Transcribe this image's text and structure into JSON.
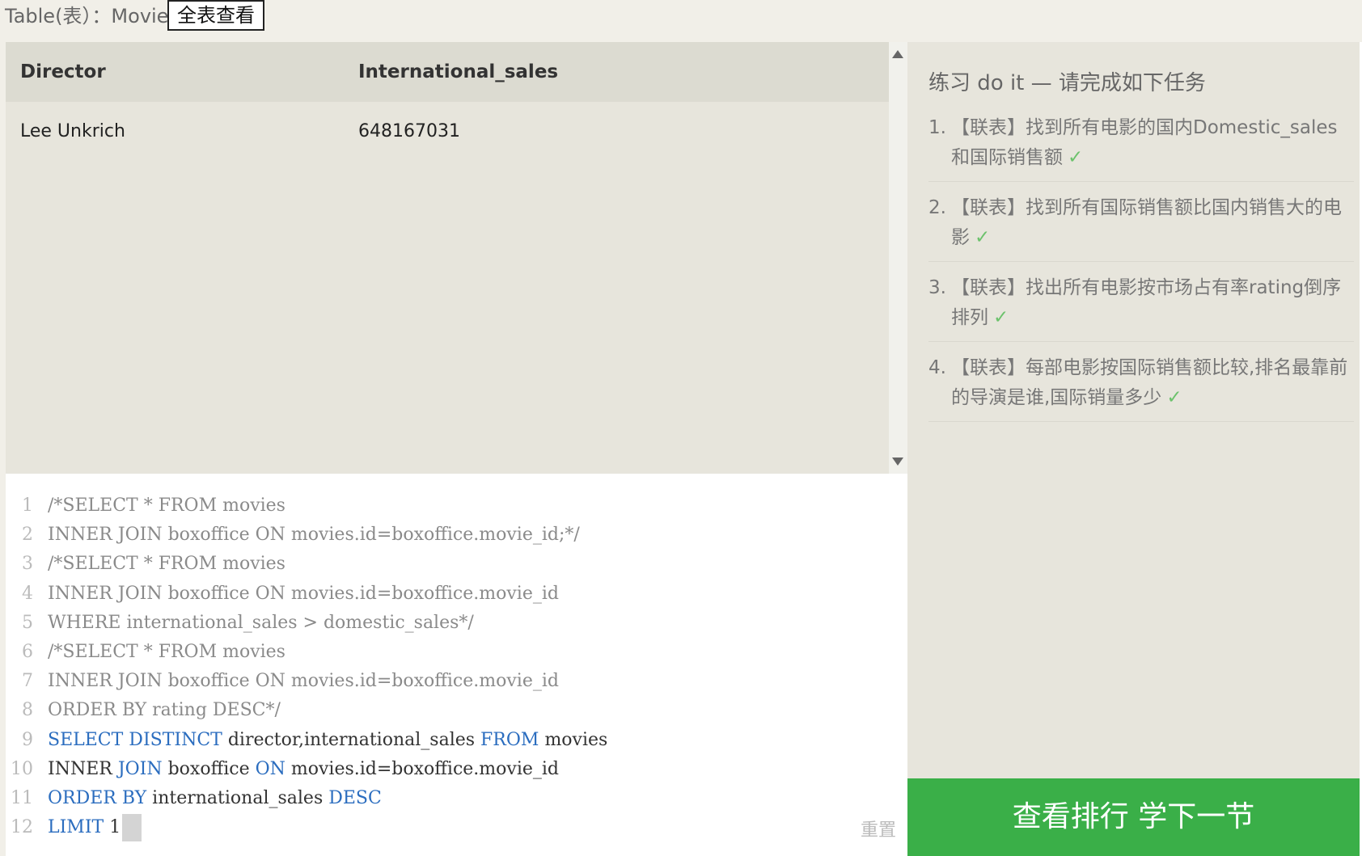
{
  "topbar": {
    "table_label": "Table(表）：Movies",
    "view_all_button": "全表查看"
  },
  "results": {
    "columns": [
      "Director",
      "International_sales"
    ],
    "rows": [
      [
        "Lee Unkrich",
        "648167031"
      ]
    ]
  },
  "editor": {
    "lines": [
      {
        "num": "1",
        "parts": [
          {
            "t": "/*SELECT * FROM movies",
            "c": "cm"
          }
        ]
      },
      {
        "num": "2",
        "parts": [
          {
            "t": "INNER JOIN boxoffice ON movies.id=boxoffice.movie_id;*/",
            "c": "cm"
          }
        ]
      },
      {
        "num": "3",
        "parts": [
          {
            "t": "/*SELECT * FROM movies",
            "c": "cm"
          }
        ]
      },
      {
        "num": "4",
        "parts": [
          {
            "t": "INNER JOIN boxoffice ON movies.id=boxoffice.movie_id",
            "c": "cm"
          }
        ]
      },
      {
        "num": "5",
        "parts": [
          {
            "t": "WHERE international_sales > domestic_sales*/",
            "c": "cm"
          }
        ]
      },
      {
        "num": "6",
        "parts": [
          {
            "t": "/*SELECT * FROM movies",
            "c": "cm"
          }
        ]
      },
      {
        "num": "7",
        "parts": [
          {
            "t": "INNER JOIN boxoffice ON movies.id=boxoffice.movie_id",
            "c": "cm"
          }
        ]
      },
      {
        "num": "8",
        "parts": [
          {
            "t": "ORDER BY rating DESC*/",
            "c": "cm"
          }
        ]
      },
      {
        "num": "9",
        "parts": [
          {
            "t": "SELECT DISTINCT",
            "c": "kw"
          },
          {
            "t": " director,international_sales ",
            "c": "tx"
          },
          {
            "t": "FROM",
            "c": "kw"
          },
          {
            "t": " movies",
            "c": "tx"
          }
        ]
      },
      {
        "num": "10",
        "parts": [
          {
            "t": "INNER ",
            "c": "tx"
          },
          {
            "t": "JOIN",
            "c": "kw"
          },
          {
            "t": " boxoffice ",
            "c": "tx"
          },
          {
            "t": "ON",
            "c": "kw"
          },
          {
            "t": " movies.id=boxoffice.movie_id",
            "c": "tx"
          }
        ]
      },
      {
        "num": "11",
        "parts": [
          {
            "t": "ORDER BY",
            "c": "kw"
          },
          {
            "t": " international_sales ",
            "c": "tx"
          },
          {
            "t": "DESC",
            "c": "kw"
          }
        ]
      },
      {
        "num": "12",
        "parts": [
          {
            "t": "LIMIT",
            "c": "kw"
          },
          {
            "t": " 1",
            "c": "tx"
          }
        ]
      }
    ],
    "reset_label": "重置"
  },
  "tasks": {
    "title": "练习 do it — 请完成如下任务",
    "check_mark": "✓",
    "items": [
      {
        "num": "1.",
        "text": "【联表】找到所有电影的国内Domestic_sales和国际销售额"
      },
      {
        "num": "2.",
        "text": "【联表】找到所有国际销售额比国内销售大的电影"
      },
      {
        "num": "3.",
        "text": "【联表】找出所有电影按市场占有率rating倒序排列"
      },
      {
        "num": "4.",
        "text": "【联表】每部电影按国际销售额比较,排名最靠前的导演是谁,国际销量多少"
      }
    ]
  },
  "action": {
    "next_button": "查看排行 学下一节"
  }
}
